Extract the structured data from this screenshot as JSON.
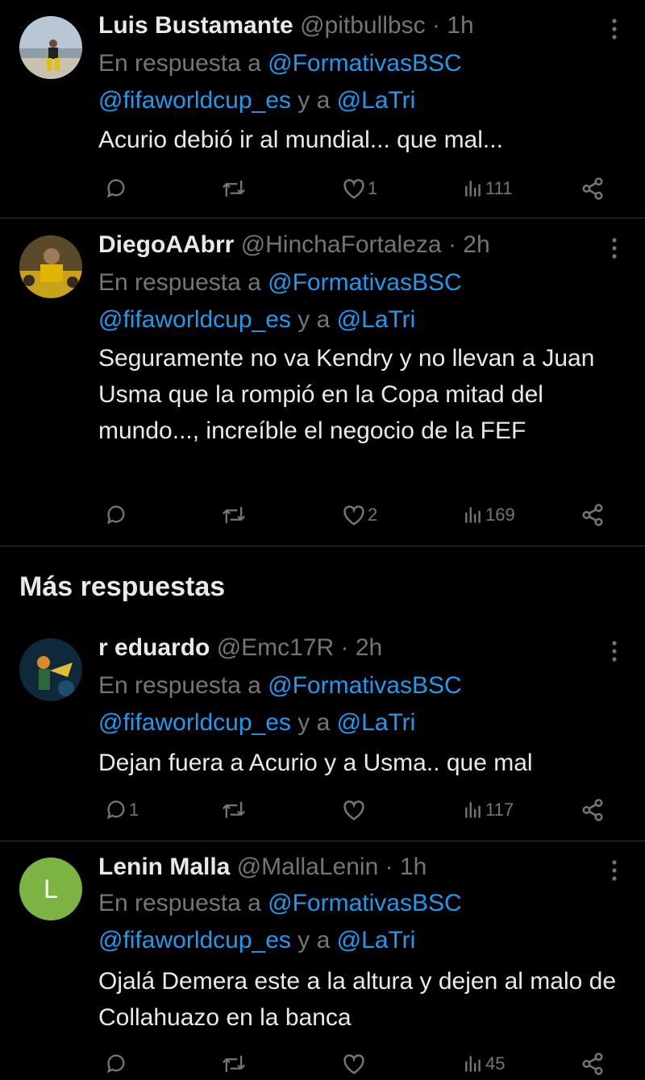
{
  "reply_prefix": "En respuesta a",
  "reply_second_line_and": "y a",
  "section_more_replies": "Más respuestas",
  "tweets": [
    {
      "name": "Luis Bustamante",
      "handle": "@pitbullbsc",
      "time": "· 1h",
      "mention1": "@FormativasBSC",
      "mention2": "@fifaworldcup_es",
      "mention3": "@LaTri",
      "body": "Acurio debió ir al mundial... que mal...",
      "replies": "",
      "retweets": "",
      "likes": "1",
      "views": "111"
    },
    {
      "name": "DiegoAAbrr",
      "handle": "@HinchaFortaleza",
      "time": "· 2h",
      "mention1": "@FormativasBSC",
      "mention2": "@fifaworldcup_es",
      "mention3": "@LaTri",
      "body": "Seguramente no va Kendry y no llevan a Juan Usma que la rompió en la Copa mitad del mundo..., increíble el negocio de la FEF",
      "replies": "",
      "retweets": "",
      "likes": "2",
      "views": "169"
    },
    {
      "name": "r eduardo",
      "handle": "@Emc17R",
      "time": "· 2h",
      "mention1": "@FormativasBSC",
      "mention2": "@fifaworldcup_es",
      "mention3": "@LaTri",
      "body": "Dejan fuera a Acurio y a Usma.. que mal",
      "replies": "1",
      "retweets": "",
      "likes": "",
      "views": "117"
    },
    {
      "name": "Lenin Malla",
      "handle": "@MallaLenin",
      "time": "· 1h",
      "avatar_letter": "L",
      "mention1": "@FormativasBSC",
      "mention2": "@fifaworldcup_es",
      "mention3": "@LaTri",
      "body": "Ojalá Demera este a la altura y dejen al malo de Collahuazo en la banca",
      "replies": "",
      "retweets": "",
      "likes": "",
      "views": "45"
    }
  ],
  "colors": {
    "background": "#000000",
    "text": "#e7e9ea",
    "muted": "#71767b",
    "link": "#1d9bf0",
    "divider": "#2f3336",
    "avatar_green": "#7cb342"
  },
  "icons": [
    "reply-icon",
    "retweet-icon",
    "like-icon",
    "views-icon",
    "share-icon",
    "more-icon"
  ]
}
